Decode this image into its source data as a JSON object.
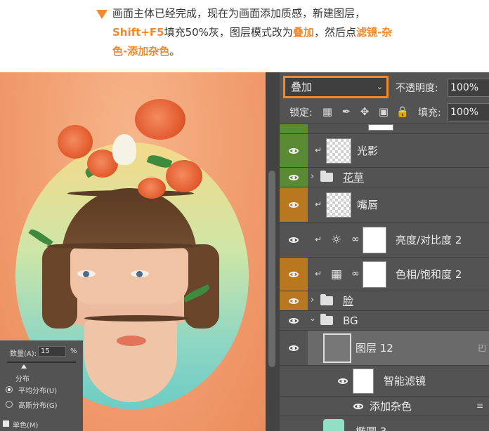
{
  "tutorial": {
    "line1": "画面主体已经完成，现在为画面添加质感，新建图层，",
    "line2_hotkey": "Shift+F5",
    "line2_rest": "填充50%灰，图层模式改为",
    "line2_mode": "叠加",
    "line2_tail": "，然后点",
    "line2_menu": "滤镜-杂",
    "line3_menu": "色-添加杂色",
    "line3_tail": "。",
    "accent_color": "#f08a2c"
  },
  "noise_dialog": {
    "amount_label": "数量(A):",
    "amount_value": "15",
    "amount_unit": "%",
    "distribution_label": "分布",
    "option_uniform": "平均分布(U)",
    "option_gaussian": "高斯分布(G)",
    "selected_option": "uniform",
    "monochrome_label": "单色(M)",
    "monochrome_checked": true
  },
  "layers_panel": {
    "blend_mode": "叠加",
    "opacity_label": "不透明度:",
    "opacity_value": "100%",
    "lock_label": "锁定:",
    "fill_label": "填充:",
    "fill_value": "100%",
    "lock_icons": [
      "lock-transparent-icon",
      "lock-paint-icon",
      "lock-move-icon",
      "lock-artboard-icon",
      "lock-all-icon"
    ],
    "layers": [
      {
        "name": "",
        "kind": "partial",
        "visible_color": "green"
      },
      {
        "name": "光影",
        "kind": "layer",
        "clipped": true,
        "visible_color": "green"
      },
      {
        "name": "花草",
        "kind": "group",
        "collapsed": true,
        "visible_color": "green"
      },
      {
        "name": "嘴唇",
        "kind": "layer",
        "clipped": true,
        "visible_color": "amber"
      },
      {
        "name": "亮度/对比度 2",
        "kind": "adjustment",
        "icon": "brightness-contrast-icon",
        "clipped": true
      },
      {
        "name": "色相/饱和度 2",
        "kind": "adjustment",
        "icon": "hue-saturation-icon",
        "clipped": true,
        "visible_color": "amber"
      },
      {
        "name": "脸",
        "kind": "group",
        "collapsed": true,
        "visible_color": "amber"
      },
      {
        "name": "BG",
        "kind": "group",
        "collapsed": false
      },
      {
        "name": "图层 12",
        "kind": "smart-object",
        "selected": true
      },
      {
        "name": "智能滤镜",
        "kind": "smart-filters"
      },
      {
        "name": "添加杂色",
        "kind": "filter"
      },
      {
        "name": "椭圆 3",
        "kind": "shape"
      }
    ]
  },
  "colors": {
    "panel_bg": "#535353",
    "vis_green": "#5b8a35",
    "vis_amber": "#b9771f",
    "highlight_border": "#f08a2c"
  }
}
